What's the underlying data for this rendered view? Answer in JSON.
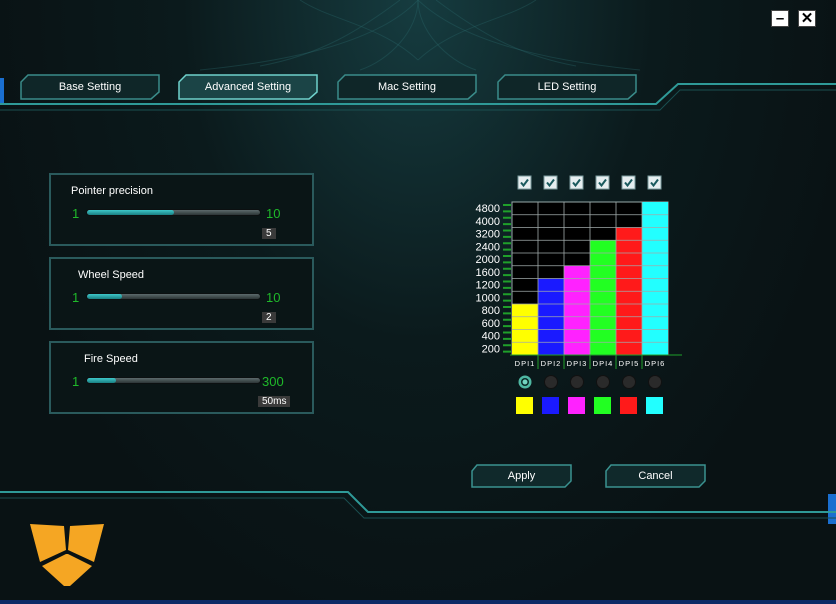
{
  "window": {
    "minimize_label": "–",
    "close_label": "✕"
  },
  "tabs": [
    {
      "label": "Base Setting",
      "active": false
    },
    {
      "label": "Advanced Setting",
      "active": true
    },
    {
      "label": "Mac Setting",
      "active": false
    },
    {
      "label": "LED Setting",
      "active": false
    }
  ],
  "settings": {
    "pointer": {
      "title": "Pointer precision",
      "min": "1",
      "max": "10",
      "value": "5",
      "level": 0.5
    },
    "wheel": {
      "title": "Wheel Speed",
      "min": "1",
      "max": "10",
      "value": "2",
      "level": 0.2
    },
    "fire": {
      "title": "Fire Speed",
      "min": "1",
      "max": "300",
      "value": "50ms",
      "level": 0.17
    }
  },
  "chart_data": {
    "type": "bar",
    "categories": [
      "DPI1",
      "DPI2",
      "DPI3",
      "DPI4",
      "DPI5",
      "DPI6"
    ],
    "y_ticks": [
      "4800",
      "4000",
      "3200",
      "2400",
      "2000",
      "1600",
      "1200",
      "1000",
      "800",
      "600",
      "400",
      "200"
    ],
    "levels": [
      4,
      6,
      7,
      9,
      10,
      12
    ],
    "colors": [
      "#ffff00",
      "#1a1aff",
      "#ff22ff",
      "#22ff22",
      "#ff1a1a",
      "#22ffff"
    ],
    "checked": [
      true,
      true,
      true,
      true,
      true,
      true
    ],
    "selected_index": 0
  },
  "actions": {
    "apply_label": "Apply",
    "cancel_label": "Cancel"
  },
  "colors": {
    "accent": "#2fa7a4",
    "slider_value": "#1fb92a",
    "logo": "#f5a623"
  }
}
